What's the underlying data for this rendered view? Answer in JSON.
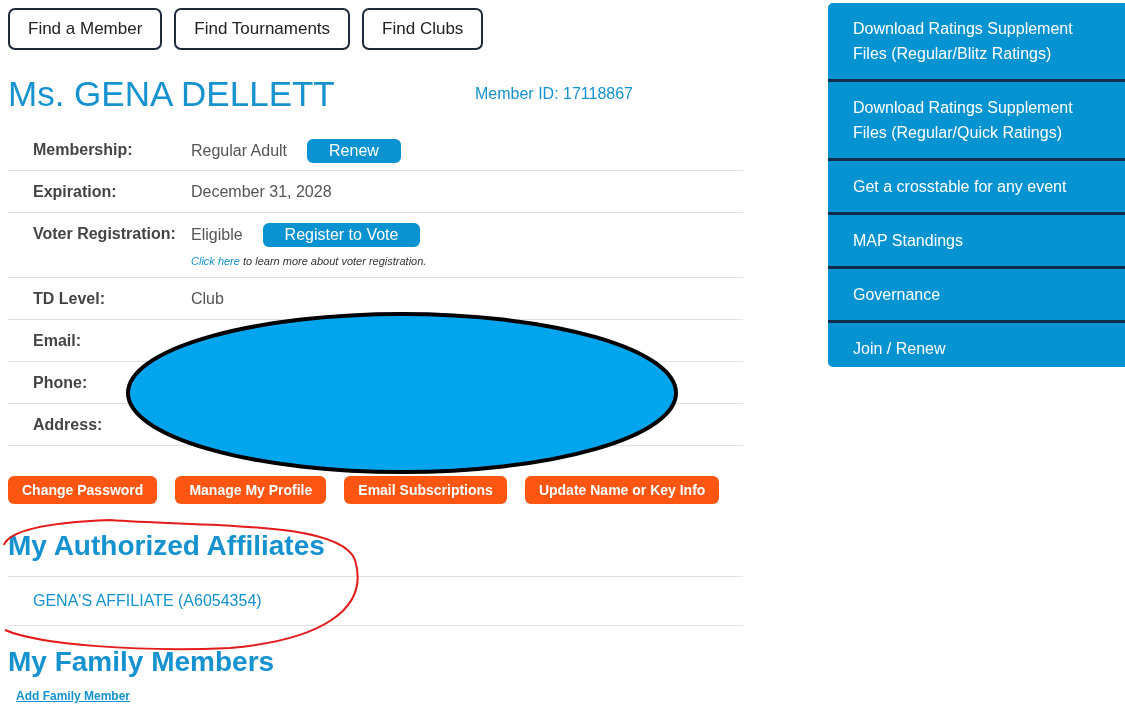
{
  "nav_buttons": [
    "Find a Member",
    "Find Tournaments",
    "Find Clubs"
  ],
  "member": {
    "name": "Ms. GENA DELLETT",
    "member_id": "Member ID: 17118867"
  },
  "details": [
    {
      "label": "Membership:",
      "value": "Regular Adult",
      "button": "Renew"
    },
    {
      "label": "Expiration:",
      "value": "December 31, 2028"
    },
    {
      "label": "Voter Registration:",
      "value": "Eligible",
      "button": "Register to Vote",
      "note": {
        "link": "Click here",
        "text": "to learn more about voter registration."
      }
    },
    {
      "label": "TD Level:",
      "value": "Club"
    },
    {
      "label": "Email:"
    },
    {
      "label": "Phone:"
    },
    {
      "label": "Address:"
    }
  ],
  "action_buttons": [
    "Change Password",
    "Manage My Profile",
    "Email Subscriptions",
    "Update Name or Key Info"
  ],
  "affiliates": {
    "heading": "My Authorized Affiliates",
    "items": [
      "GENA'S AFFILIATE (A6054354)"
    ]
  },
  "family": {
    "heading": "My Family Members",
    "link": "Add Family Member"
  },
  "sidebar": {
    "items": [
      "Download Ratings Supplement Files (Regular/Blitz Ratings)",
      "Download Ratings Supplement Files (Regular/Quick Ratings)",
      "Get a crosstable for any event",
      "MAP Standings",
      "Governance",
      "Join / Renew"
    ]
  }
}
